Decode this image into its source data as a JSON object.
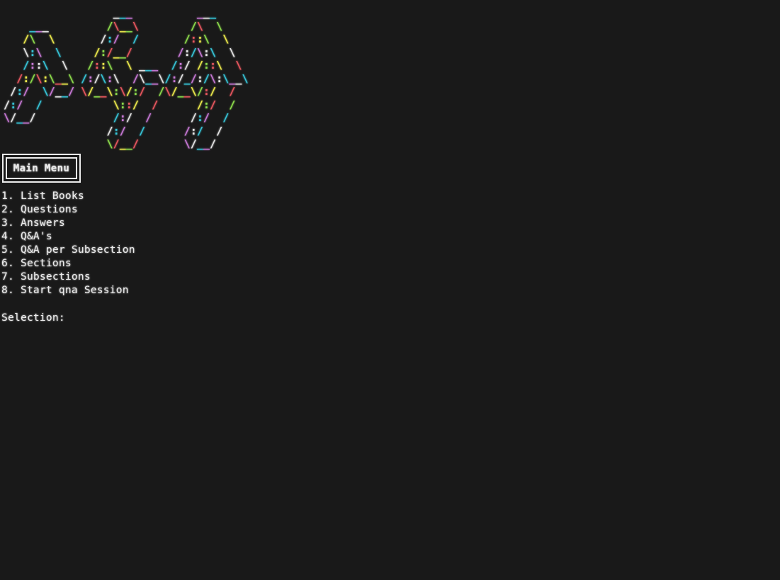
{
  "banner": {
    "lines": [
      "                 ___          ___    ",
      "    ___         /\\__\\        /\\  \\   ",
      "   /\\  \\       /:/  /       /::\\  \\  ",
      "   \\:\\  \\     /:/__/       /:/\\:\\  \\ ",
      "   /::\\  \\   /::\\  \\ ___  /:/ /::\\  \\",
      "  /:/\\:\\__\\ /:/\\:\\  /\\__\\/:/_/:/\\:\\__\\",
      " /:/  \\/__/ \\/__\\:\\/:/  /\\/__\\/:/  /",
      "/:/  /           \\::/  /      /:/  / ",
      "\\/__/            /:/  /      /:/  /  ",
      "                /:/  /      /:/  /   ",
      "                \\/__/       \\/__/    "
    ],
    "palette": [
      "#e9575f",
      "#37c5d8",
      "#ece94c",
      "#c879d6",
      "#8ddc4c",
      "#e7e7e7"
    ]
  },
  "menu": {
    "title": "Main Menu",
    "items": [
      "1. List Books",
      "2. Questions",
      "3. Answers",
      "4. Q&A's",
      "5. Q&A per Subsection",
      "6. Sections",
      "7. Subsections",
      "8. Start qna Session"
    ]
  },
  "prompt": {
    "label": "Selection:",
    "value": ""
  }
}
